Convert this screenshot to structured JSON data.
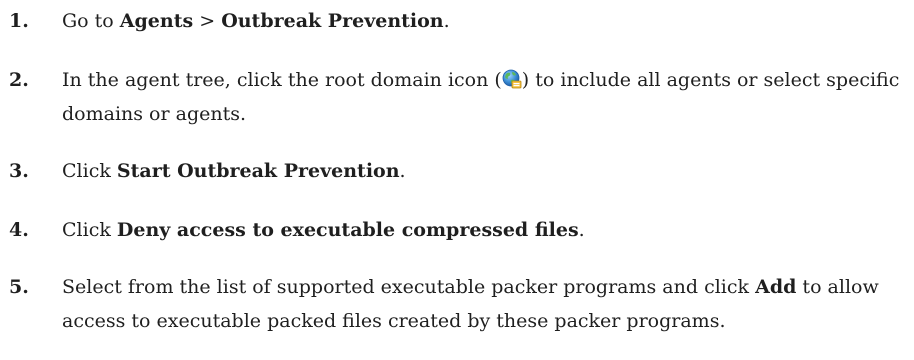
{
  "steps": [
    {
      "number": "1.",
      "parts": [
        {
          "t": "Go to "
        },
        {
          "t": "Agents",
          "b": true
        },
        {
          "t": " > "
        },
        {
          "t": "Outbreak Prevention",
          "b": true
        },
        {
          "t": "."
        }
      ]
    },
    {
      "number": "2.",
      "parts": [
        {
          "t": "In the agent tree, click the root domain icon ("
        },
        {
          "icon": "root-domain-globe-icon"
        },
        {
          "t": ") to include all agents or select specific domains or agents."
        }
      ]
    },
    {
      "number": "3.",
      "parts": [
        {
          "t": "Click "
        },
        {
          "t": "Start Outbreak Prevention",
          "b": true
        },
        {
          "t": "."
        }
      ]
    },
    {
      "number": "4.",
      "parts": [
        {
          "t": "Click "
        },
        {
          "t": "Deny access to executable compressed files",
          "b": true
        },
        {
          "t": "."
        }
      ]
    },
    {
      "number": "5.",
      "parts": [
        {
          "t": "Select from the list of supported executable packer programs and click "
        },
        {
          "t": "Add",
          "b": true
        },
        {
          "t": " to allow access to executable packed files created by these packer programs."
        }
      ]
    }
  ]
}
